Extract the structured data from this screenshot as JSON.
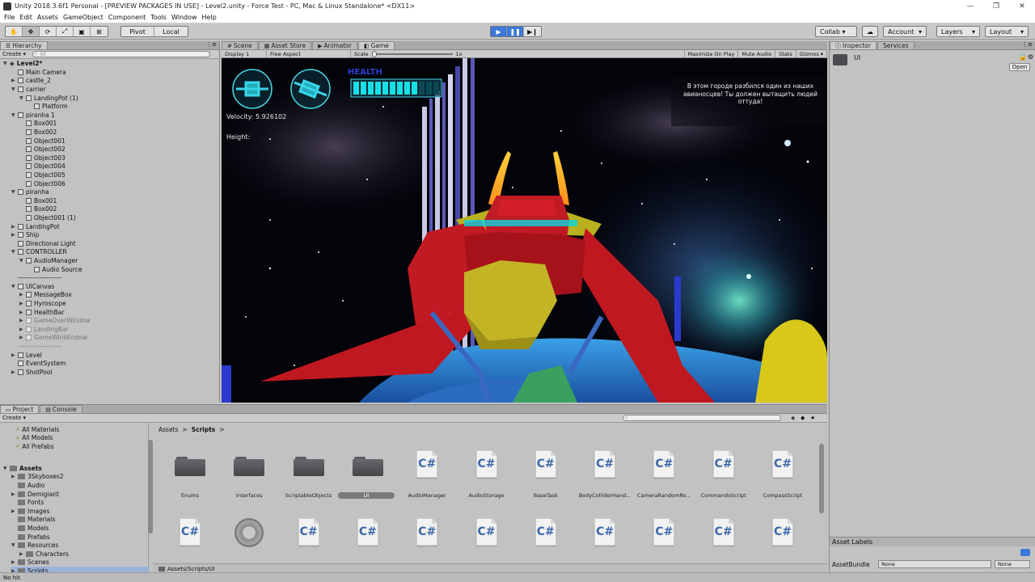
{
  "window": {
    "title": "Unity 2018.3.6f1 Personal - [PREVIEW PACKAGES IN USE] - Level2.unity - Force Test - PC, Mac & Linux Standalone* <DX11>",
    "min": "—",
    "max": "❐",
    "close": "✕"
  },
  "menu": [
    "File",
    "Edit",
    "Assets",
    "GameObject",
    "Component",
    "Tools",
    "Window",
    "Help"
  ],
  "toolbar": {
    "pivot": "Pivot",
    "local": "Local",
    "collab": "Collab ▾",
    "account": "Account",
    "layers": "Layers",
    "layout": "Layout"
  },
  "hierarchy": {
    "tab": "Hierarchy",
    "create": "Create ▾",
    "search_placeholder": "All",
    "scene": "Level2*",
    "rows": [
      {
        "label": "Main Camera",
        "indent": 1,
        "arrow": ""
      },
      {
        "label": "castle_2",
        "indent": 1,
        "arrow": "▶"
      },
      {
        "label": "carrier",
        "indent": 1,
        "arrow": "▼"
      },
      {
        "label": "LandingPot (1)",
        "indent": 2,
        "arrow": "▼"
      },
      {
        "label": "Platform",
        "indent": 3,
        "arrow": ""
      },
      {
        "label": "piranha 1",
        "indent": 1,
        "arrow": "▼"
      },
      {
        "label": "Box001",
        "indent": 2,
        "arrow": ""
      },
      {
        "label": "Box002",
        "indent": 2,
        "arrow": ""
      },
      {
        "label": "Object001",
        "indent": 2,
        "arrow": ""
      },
      {
        "label": "Object002",
        "indent": 2,
        "arrow": ""
      },
      {
        "label": "Object003",
        "indent": 2,
        "arrow": ""
      },
      {
        "label": "Object004",
        "indent": 2,
        "arrow": ""
      },
      {
        "label": "Object005",
        "indent": 2,
        "arrow": ""
      },
      {
        "label": "Object006",
        "indent": 2,
        "arrow": ""
      },
      {
        "label": "piranha",
        "indent": 1,
        "arrow": "▼"
      },
      {
        "label": "Box001",
        "indent": 2,
        "arrow": ""
      },
      {
        "label": "Box002",
        "indent": 2,
        "arrow": ""
      },
      {
        "label": "Object001 (1)",
        "indent": 2,
        "arrow": ""
      },
      {
        "label": "LandingPot",
        "indent": 1,
        "arrow": "▶"
      },
      {
        "label": "Ship",
        "indent": 1,
        "arrow": "▶"
      },
      {
        "label": "Directional Light",
        "indent": 1,
        "arrow": ""
      },
      {
        "label": "CONTROLLER",
        "indent": 1,
        "arrow": "▼"
      },
      {
        "label": "AudioManager",
        "indent": 2,
        "arrow": "▼"
      },
      {
        "label": "Audio Source",
        "indent": 3,
        "arrow": ""
      },
      {
        "label": "--------------------",
        "indent": 1,
        "arrow": ""
      },
      {
        "label": "UICanvas",
        "indent": 1,
        "arrow": "▼"
      },
      {
        "label": "MessageBox",
        "indent": 2,
        "arrow": "▶"
      },
      {
        "label": "Hyroscope",
        "indent": 2,
        "arrow": "▶"
      },
      {
        "label": "HealthBar",
        "indent": 2,
        "arrow": "▶"
      },
      {
        "label": "GameOverWindow",
        "indent": 2,
        "arrow": "▶",
        "dim": true
      },
      {
        "label": "LandingBar",
        "indent": 2,
        "arrow": "▶",
        "dim": true
      },
      {
        "label": "GameWinWindow",
        "indent": 2,
        "arrow": "▶",
        "dim": true
      },
      {
        "label": "--------------------",
        "indent": 1,
        "arrow": "",
        "dim": true
      },
      {
        "label": "Level",
        "indent": 1,
        "arrow": "▶"
      },
      {
        "label": "EventSystem",
        "indent": 1,
        "arrow": ""
      },
      {
        "label": "ShotPool",
        "indent": 1,
        "arrow": "▶"
      }
    ]
  },
  "center_tabs": [
    "Scene",
    "Asset Store",
    "Animator",
    "Game"
  ],
  "gamebar": {
    "display": "Display 1",
    "aspect": "Free Aspect",
    "scale": "Scale",
    "scale_value": "1x",
    "maximize": "Maximize On Play",
    "mute": "Mute Audio",
    "stats": "Stats",
    "gizmos": "Gizmos"
  },
  "hud": {
    "health_label": "HEALTH",
    "health_fraction": 0.75,
    "velocity": "Velocity: 5.926102",
    "height": "Height:",
    "message": "В этом городе разбился один из наших авианосцев! Ты должен вытащить людей оттуда!"
  },
  "inspector": {
    "tab": "Inspector",
    "tab2": "Services",
    "asset_name": "UI",
    "open": "Open",
    "asset_labels": "Asset Labels",
    "assetbundle": "AssetBundle",
    "none1": "None",
    "none2": "None"
  },
  "project": {
    "tab": "Project",
    "tab2": "Console",
    "create": "Create ▾",
    "favorites": [
      "All Materials",
      "All Models",
      "All Prefabs"
    ],
    "assets_root": "Assets",
    "tree": [
      {
        "label": "3Skyboxes2",
        "arrow": "▶",
        "indent": 1
      },
      {
        "label": "Audio",
        "arrow": "",
        "indent": 1
      },
      {
        "label": "Demigiant",
        "arrow": "▶",
        "indent": 1
      },
      {
        "label": "Fonts",
        "arrow": "",
        "indent": 1
      },
      {
        "label": "Images",
        "arrow": "▶",
        "indent": 1
      },
      {
        "label": "Materials",
        "arrow": "",
        "indent": 1
      },
      {
        "label": "Models",
        "arrow": "",
        "indent": 1
      },
      {
        "label": "Prefabs",
        "arrow": "",
        "indent": 1
      },
      {
        "label": "Resources",
        "arrow": "▼",
        "indent": 1
      },
      {
        "label": "Characters",
        "arrow": "▶",
        "indent": 2
      },
      {
        "label": "Scenes",
        "arrow": "▶",
        "indent": 1
      },
      {
        "label": "Scripts",
        "arrow": "▶",
        "indent": 1,
        "selected": true
      }
    ],
    "breadcrumb_root": "Assets",
    "breadcrumb_sep": ">",
    "breadcrumb_current": "Scripts",
    "row1": [
      {
        "label": "Enums",
        "type": "folder"
      },
      {
        "label": "Interfaces",
        "type": "folder"
      },
      {
        "label": "ScriptableObjects",
        "type": "folder"
      },
      {
        "label": "UI",
        "type": "folder",
        "selected": true
      },
      {
        "label": "AudioManager",
        "type": "cs"
      },
      {
        "label": "AudioStorage",
        "type": "cs"
      },
      {
        "label": "BaseTask",
        "type": "cs"
      },
      {
        "label": "BodyColliderHand...",
        "type": "cs"
      },
      {
        "label": "CameraRandomRo...",
        "type": "cs"
      },
      {
        "label": "CommandoScript",
        "type": "cs"
      },
      {
        "label": "CompassScript",
        "type": "cs"
      }
    ],
    "row2": [
      "cs",
      "gear",
      "cs",
      "cs",
      "cs",
      "cs",
      "cs",
      "cs",
      "cs",
      "cs",
      "cs"
    ],
    "cs_glyph": "C#",
    "path": "Assets/Scripts/UI"
  },
  "status": "No hit"
}
